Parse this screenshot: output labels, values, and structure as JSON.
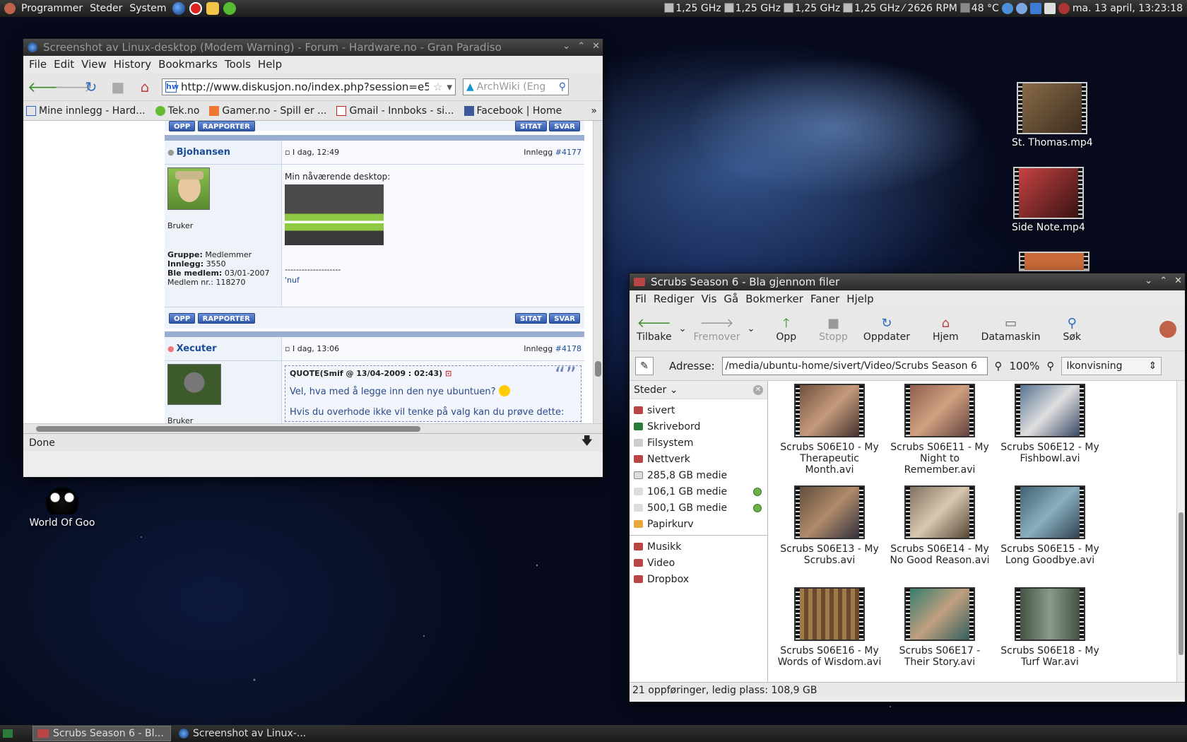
{
  "top_panel": {
    "menus": [
      "Programmer",
      "Steder",
      "System"
    ],
    "cpu_freqs": [
      "1,25 GHz",
      "1,25 GHz",
      "1,25 GHz",
      "1,25 GHz"
    ],
    "fan": "2626 RPM",
    "temp": "48 °C",
    "clock": "ma. 13 april, 13:23:18"
  },
  "browser": {
    "title": "Screenshot av Linux-desktop (Modem Warning) - Forum - Hardware.no - Gran Paradiso",
    "menu": [
      "File",
      "Edit",
      "View",
      "History",
      "Bookmarks",
      "Tools",
      "Help"
    ],
    "url": "http://www.diskusjon.no/index.php?session=e5fd",
    "search_placeholder": "ArchWiki (Eng",
    "bookmarks": [
      "Mine innlegg - Hard...",
      "Tek.no",
      "Gamer.no - Spill er ...",
      "Gmail - Innboks - si...",
      "Facebook | Home"
    ],
    "status": "Done",
    "buttons": {
      "up": "OPP",
      "report": "RAPPORTER",
      "quote": "SITAT",
      "reply": "SVAR"
    },
    "post1": {
      "user": "Bjohansen",
      "time": "I dag, 12:49",
      "post_label": "Innlegg",
      "post_no": "#4177",
      "rank": "Bruker",
      "group_label": "Gruppe:",
      "group": "Medlemmer",
      "posts_label": "Innlegg:",
      "posts": "3550",
      "joined_label": "Ble medlem:",
      "joined": "03/01-2007",
      "memberno": "Medlem nr.: 118270",
      "text": "Min nåværende desktop:",
      "sig_line": "--------------------",
      "sig": "'nuf"
    },
    "post2": {
      "user": "Xecuter",
      "time": "I dag, 13:06",
      "post_label": "Innlegg",
      "post_no": "#4178",
      "rank": "Bruker",
      "quote_header": "QUOTE(Smif @ 13/04-2009 : 02:43)",
      "quote_text": "Vel, hva med å legge inn den nye ubuntuen?",
      "quote_text2": "Hvis du overhode ikke vil tenke på valg kan du prøve dette:"
    }
  },
  "nautilus": {
    "title": "Scrubs Season 6 - Bla gjennom filer",
    "menu": [
      "Fil",
      "Rediger",
      "Vis",
      "Gå",
      "Bokmerker",
      "Faner",
      "Hjelp"
    ],
    "toolbar": [
      "Tilbake",
      "Fremover",
      "Opp",
      "Stopp",
      "Oppdater",
      "Hjem",
      "Datamaskin",
      "Søk"
    ],
    "address_label": "Adresse:",
    "address": "/media/ubuntu-home/sivert/Video/Scrubs Season 6",
    "zoom": "100%",
    "view": "Ikonvisning",
    "sidebar_title": "Steder",
    "places": [
      "sivert",
      "Skrivebord",
      "Filsystem",
      "Nettverk",
      "285,8 GB medie",
      "106,1 GB medie",
      "500,1 GB medie",
      "Papirkurv"
    ],
    "bookmarks": [
      "Musikk",
      "Video",
      "Dropbox"
    ],
    "files": [
      "Scrubs S06E10 - My Therapeutic Month.avi",
      "Scrubs S06E11 - My Night to Remember.avi",
      "Scrubs S06E12 - My Fishbowl.avi",
      "Scrubs S06E13 - My Scrubs.avi",
      "Scrubs S06E14 - My No Good Reason.avi",
      "Scrubs S06E15 - My Long Goodbye.avi",
      "Scrubs S06E16 - My Words of Wisdom.avi",
      "Scrubs S06E17 - Their Story.avi",
      "Scrubs S06E18 - My Turf War.avi"
    ],
    "status": "21 oppføringer, ledig plass: 108,9 GB"
  },
  "desktop_icons": [
    "St. Thomas.mp4",
    "Side Note.mp4",
    "World Of Goo"
  ],
  "taskbar": [
    "Scrubs Season 6 - Bl...",
    "Screenshot av Linux-..."
  ]
}
